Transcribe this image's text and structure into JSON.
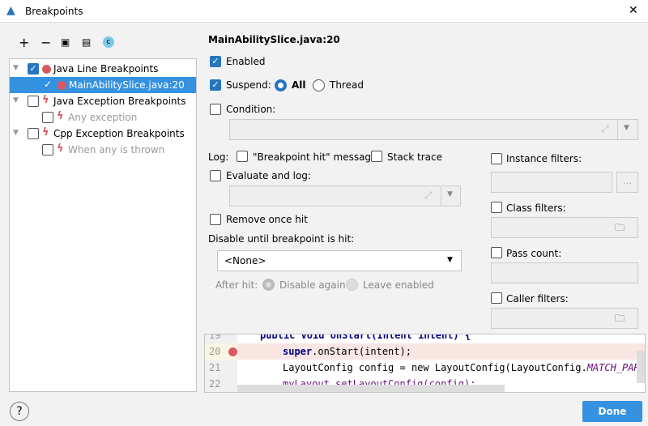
{
  "window": {
    "title": "Breakpoints",
    "close": "✕"
  },
  "toolbar": {
    "add": "+",
    "remove": "−",
    "group_file": "▣",
    "group_package": "▤",
    "group_class": "c"
  },
  "tree": [
    {
      "label": "Java Line Breakpoints",
      "checked": true,
      "icon": "breakpoint-dot"
    },
    {
      "label": "MainAbilitySlice.java:20",
      "checked": true,
      "icon": "breakpoint-dot",
      "selected": true
    },
    {
      "label": "Java Exception Breakpoints",
      "checked": false,
      "icon": "lightning"
    },
    {
      "label": "Any exception",
      "checked": false,
      "icon": "lightning",
      "disabled": true
    },
    {
      "label": "Cpp Exception Breakpoints",
      "checked": false,
      "icon": "lightning"
    },
    {
      "label": "When any is thrown",
      "checked": false,
      "icon": "lightning",
      "disabled": true
    }
  ],
  "details": {
    "title": "MainAbilitySlice.java:20",
    "enabled": "Enabled",
    "suspend": "Suspend:",
    "all": "All",
    "thread": "Thread",
    "condition": "Condition:",
    "log": "Log:",
    "bp_hit_message": "\"Breakpoint hit\" message",
    "stack_trace": "Stack trace",
    "evaluate_and_log": "Evaluate and log:",
    "remove_once_hit": "Remove once hit",
    "disable_until": "Disable until breakpoint is hit:",
    "disable_select": "<None>",
    "after_hit": "After hit:",
    "disable_again": "Disable again",
    "leave_enabled": "Leave enabled",
    "instance_filters": "Instance filters:",
    "instance_btn": "...",
    "class_filters": "Class filters:",
    "pass_count": "Pass count:",
    "caller_filters": "Caller filters:"
  },
  "code": {
    "lines": [
      {
        "n": "19",
        "text": "public void onStart(Intent intent) {"
      },
      {
        "n": "20",
        "pre": "super",
        "text": ".onStart(intent);"
      },
      {
        "n": "21",
        "text": "LayoutConfig config = new LayoutConfig(LayoutConfig.",
        "italic": "MATCH_PARENT"
      },
      {
        "n": "22",
        "text": "myLayout.setLayoutConfig(config);"
      }
    ]
  },
  "footer": {
    "help": "?",
    "done": "Done"
  },
  "colors": {
    "accent": "#2675bf",
    "breakpoint": "#db5860",
    "selection": "#3592e0"
  }
}
